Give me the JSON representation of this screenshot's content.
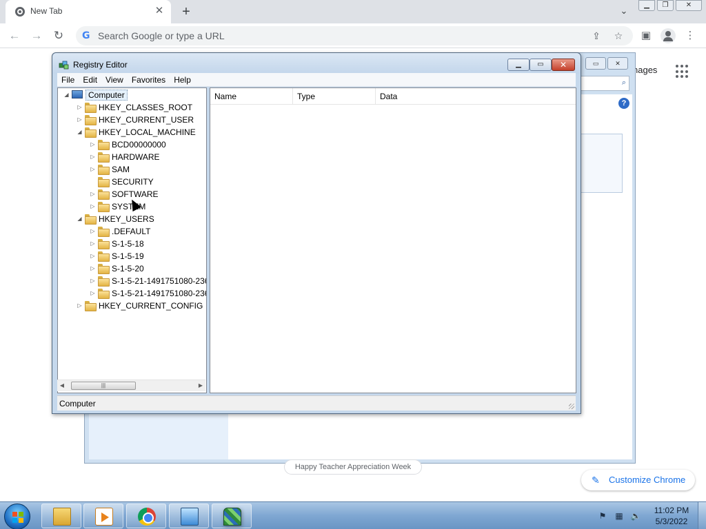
{
  "chrome": {
    "tab_title": "New Tab",
    "omnibox_placeholder": "Search Google or type a URL",
    "images_link": "nages",
    "doodle_share": "Happy Teacher Appreciation Week",
    "customize_label": "Customize Chrome"
  },
  "regedit": {
    "title": "Registry Editor",
    "menu": [
      "File",
      "Edit",
      "View",
      "Favorites",
      "Help"
    ],
    "columns": [
      "Name",
      "Type",
      "Data"
    ],
    "status": "Computer",
    "tree": [
      {
        "label": "Computer",
        "level": 0,
        "expander": "expanded",
        "icon": "computer-icon"
      },
      {
        "label": "HKEY_CLASSES_ROOT",
        "level": 1,
        "expander": "collapsed",
        "icon": "folder-icon"
      },
      {
        "label": "HKEY_CURRENT_USER",
        "level": 1,
        "expander": "collapsed",
        "icon": "folder-icon"
      },
      {
        "label": "HKEY_LOCAL_MACHINE",
        "level": 1,
        "expander": "expanded",
        "icon": "folder-icon"
      },
      {
        "label": "BCD00000000",
        "level": 2,
        "expander": "collapsed",
        "icon": "folder-icon"
      },
      {
        "label": "HARDWARE",
        "level": 2,
        "expander": "collapsed",
        "icon": "folder-icon"
      },
      {
        "label": "SAM",
        "level": 2,
        "expander": "collapsed",
        "icon": "folder-icon"
      },
      {
        "label": "SECURITY",
        "level": 2,
        "expander": "none",
        "icon": "folder-icon"
      },
      {
        "label": "SOFTWARE",
        "level": 2,
        "expander": "collapsed",
        "icon": "folder-icon"
      },
      {
        "label": "SYSTEM",
        "level": 2,
        "expander": "collapsed",
        "icon": "folder-icon"
      },
      {
        "label": "HKEY_USERS",
        "level": 1,
        "expander": "expanded",
        "icon": "folder-icon"
      },
      {
        "label": ".DEFAULT",
        "level": 2,
        "expander": "collapsed",
        "icon": "folder-icon"
      },
      {
        "label": "S-1-5-18",
        "level": 2,
        "expander": "collapsed",
        "icon": "folder-icon"
      },
      {
        "label": "S-1-5-19",
        "level": 2,
        "expander": "collapsed",
        "icon": "folder-icon"
      },
      {
        "label": "S-1-5-20",
        "level": 2,
        "expander": "collapsed",
        "icon": "folder-icon"
      },
      {
        "label": "S-1-5-21-1491751080-236",
        "level": 2,
        "expander": "collapsed",
        "icon": "folder-icon"
      },
      {
        "label": "S-1-5-21-1491751080-236",
        "level": 2,
        "expander": "collapsed",
        "icon": "folder-icon"
      },
      {
        "label": "HKEY_CURRENT_CONFIG",
        "level": 1,
        "expander": "collapsed",
        "icon": "folder-icon"
      }
    ]
  },
  "taskbar": {
    "time": "11:02 PM",
    "date": "5/3/2022",
    "apps": [
      "explorer-icon",
      "media-player-icon",
      "chrome-icon",
      "remote-desktop-icon",
      "registry-editor-icon"
    ]
  },
  "colors": {
    "taskbar": "#7fa7d2",
    "regedit_frame": "#c5d8ec",
    "close_button": "#c4402b",
    "chrome_accent": "#1a73e8"
  }
}
